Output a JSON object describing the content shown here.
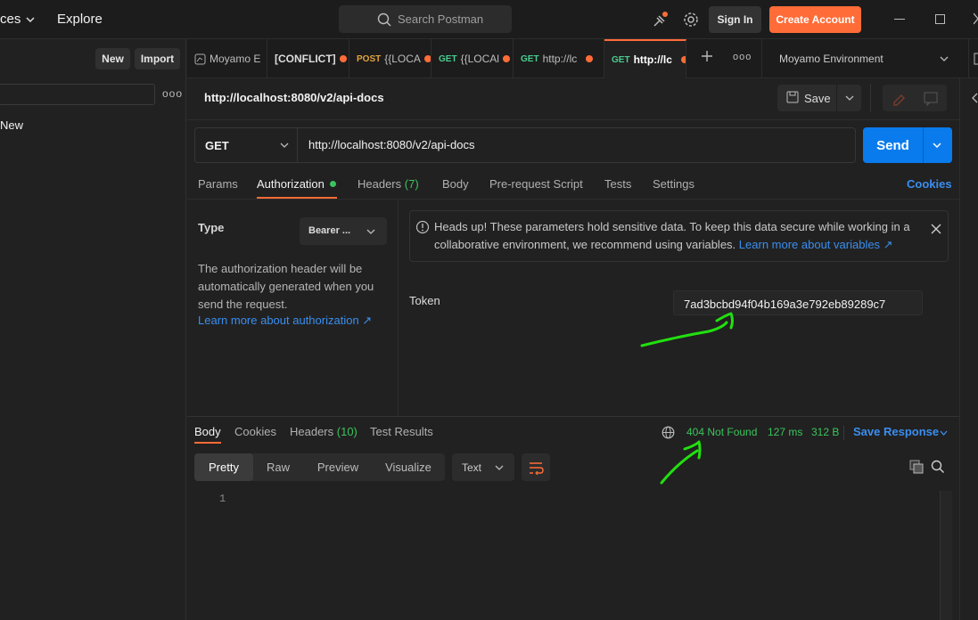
{
  "topbar": {
    "workspaces": "ces",
    "explore": "Explore",
    "search_placeholder": "Search Postman",
    "sign_in": "Sign In",
    "create_account": "Create Account"
  },
  "sidebar": {
    "new_label": "New",
    "import_label": "Import",
    "item_new": "New"
  },
  "tabs": [
    {
      "method": "",
      "label": "Moyamo E"
    },
    {
      "method": "",
      "label": "[CONFLICT]"
    },
    {
      "method": "POST",
      "label": "{{LOCA"
    },
    {
      "method": "GET",
      "label": "{{LOCAl"
    },
    {
      "method": "GET",
      "label": "http://lc"
    },
    {
      "method": "GET",
      "label": "http://lc"
    }
  ],
  "environment": "Moyamo Environment",
  "request": {
    "title": "http://localhost:8080/v2/api-docs",
    "save": "Save",
    "method": "GET",
    "url": "http://localhost:8080/v2/api-docs",
    "send": "Send"
  },
  "request_tabs": {
    "params": "Params",
    "authorization": "Authorization",
    "headers": "Headers",
    "headers_count": "(7)",
    "body": "Body",
    "prerequest": "Pre-request Script",
    "tests": "Tests",
    "settings": "Settings",
    "cookies": "Cookies"
  },
  "auth": {
    "type_label": "Type",
    "type_value": "Bearer ...",
    "description": "The authorization header will be automatically generated when you send the request.",
    "learn_more": "Learn more about authorization ↗",
    "notice_text": "Heads up! These parameters hold sensitive data. To keep this data secure while working in a collaborative environment, we recommend using variables.",
    "notice_link": "Learn more about variables ↗",
    "token_label": "Token",
    "token_value": "7ad3bcbd94f04b169a3e792eb89289c7"
  },
  "response": {
    "tabs": {
      "body": "Body",
      "cookies": "Cookies",
      "headers": "Headers",
      "headers_count": "(10)",
      "test_results": "Test Results"
    },
    "status_code": "404",
    "status_text": "Not Found",
    "time": "127 ms",
    "size": "312 B",
    "save_response": "Save Response",
    "view_tabs": [
      "Pretty",
      "Raw",
      "Preview",
      "Visualize"
    ],
    "format": "Text",
    "line_number": "1"
  },
  "colors": {
    "accent": "#ff6c37",
    "send": "#097bed",
    "status_green": "#3cc45c",
    "annotation": "#22e010"
  }
}
